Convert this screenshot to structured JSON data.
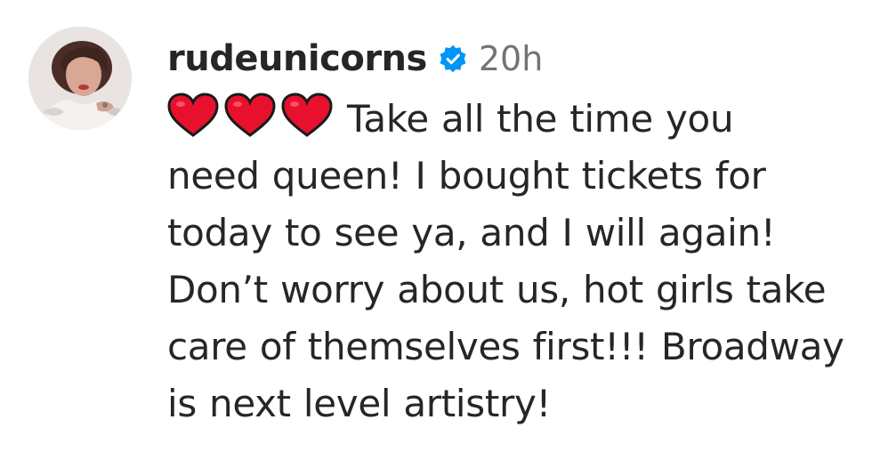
{
  "comment": {
    "username": "rudeunicorns",
    "verified": true,
    "timestamp": "20h",
    "avatar_icon": "profile-photo",
    "emoji": [
      "red-heart-icon",
      "red-heart-icon",
      "red-heart-icon"
    ],
    "text_lines": [
      "Take all the time you",
      "need queen! I bought tickets for",
      "today to see ya, and I will again!",
      "Don’t worry about us, hot girls take",
      "care of themselves first!!! Broadway",
      "is next level artistry!"
    ]
  },
  "colors": {
    "username": "#262626",
    "timestamp": "#737373",
    "verified_badge": "#0095f6",
    "heart": "#e8112d"
  }
}
